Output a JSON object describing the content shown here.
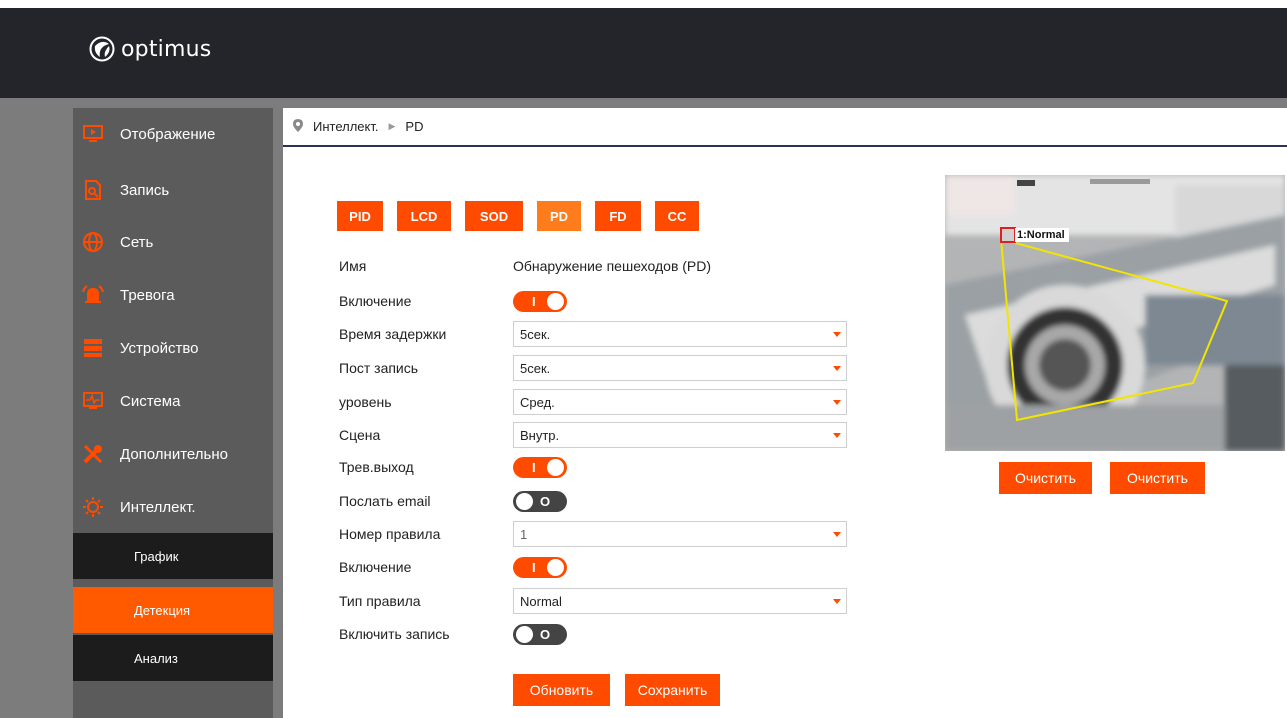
{
  "app": {
    "logo_text": "optimus"
  },
  "sidebar": {
    "items": [
      {
        "label": "Отображение",
        "icon": "monitor-play-icon"
      },
      {
        "label": "Запись",
        "icon": "record-search-icon"
      },
      {
        "label": "Сеть",
        "icon": "globe-icon"
      },
      {
        "label": "Тревога",
        "icon": "alarm-bell-icon"
      },
      {
        "label": "Устройство",
        "icon": "server-icon"
      },
      {
        "label": "Система",
        "icon": "system-monitor-icon"
      },
      {
        "label": "Дополнительно",
        "icon": "tools-icon"
      },
      {
        "label": "Интеллект.",
        "icon": "intelligence-icon"
      }
    ],
    "subitems": [
      {
        "label": "График",
        "active": false
      },
      {
        "label": "Детекция",
        "active": true
      },
      {
        "label": "Анализ",
        "active": false
      }
    ]
  },
  "breadcrumb": {
    "section": "Интеллект.",
    "page": "PD"
  },
  "tabs": [
    {
      "label": "PID",
      "active": false
    },
    {
      "label": "LCD",
      "active": false
    },
    {
      "label": "SOD",
      "active": false
    },
    {
      "label": "PD",
      "active": true
    },
    {
      "label": "FD",
      "active": false
    },
    {
      "label": "CC",
      "active": false
    }
  ],
  "form": {
    "name_label": "Имя",
    "name_value": "Обнаружение пешеходов (PD)",
    "enable_label": "Включение",
    "enable_state": "on",
    "delay_label": "Время задержки",
    "delay_value": "5сек.",
    "post_record_label": "Пост запись",
    "post_record_value": "5сек.",
    "level_label": "уровень",
    "level_value": "Сред.",
    "scene_label": "Сцена",
    "scene_value": "Внутр.",
    "alarm_out_label": "Трев.выход",
    "alarm_out_state": "on",
    "email_label": "Послать email",
    "email_state": "off",
    "rule_number_label": "Номер правила",
    "rule_number_value": "1",
    "rule_enable_label": "Включение",
    "rule_enable_state": "on",
    "rule_type_label": "Тип правила",
    "rule_type_value": "Normal",
    "record_label": "Включить запись",
    "record_state": "off",
    "toggle_on_mark": "I",
    "toggle_off_mark": "O"
  },
  "buttons": {
    "refresh": "Обновить",
    "save": "Сохранить",
    "clear_1": "Очистить",
    "clear_2": "Очистить"
  },
  "preview": {
    "rule_label": "1:Normal",
    "polygon_color": "#f2e600"
  },
  "colors": {
    "accent": "#ff4b00",
    "accent_active_tab": "#ff7c1c",
    "topbar": "#23252a",
    "sidebar": "#5b5b5b"
  }
}
